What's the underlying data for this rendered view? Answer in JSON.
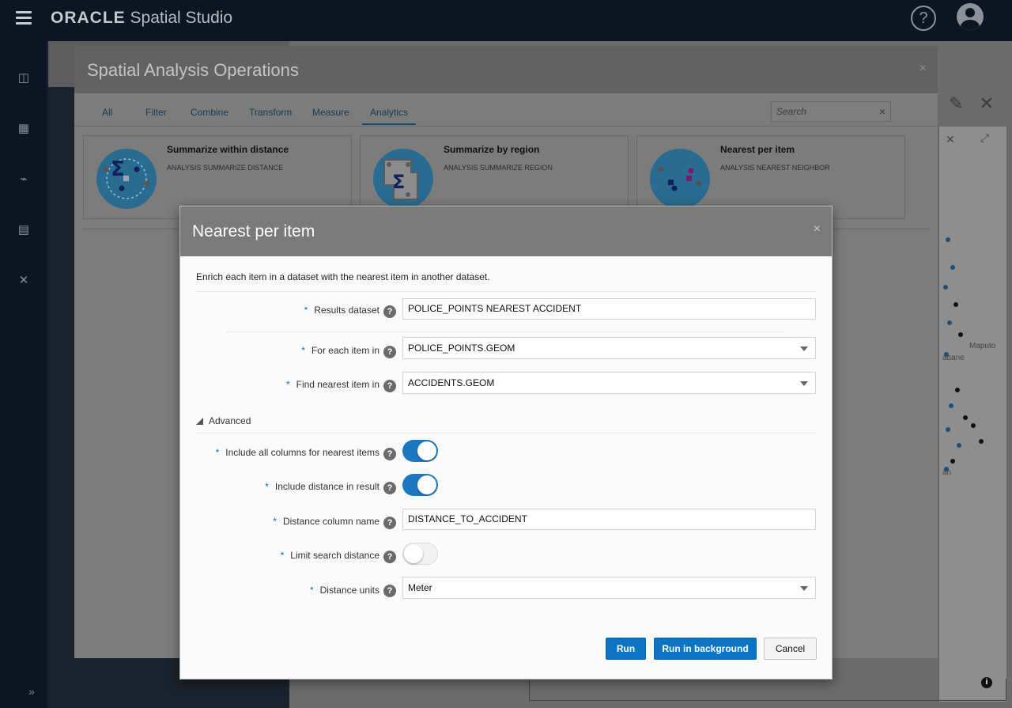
{
  "app": {
    "brand_logo": "ORACLE",
    "brand_product": "Spatial Studio",
    "help_glyph": "?"
  },
  "background": {
    "map_labels": [
      "Maputo",
      "abane",
      "an"
    ]
  },
  "operations_dialog": {
    "title": "Spatial Analysis Operations",
    "close_glyph": "×",
    "tabs": [
      {
        "label": "All"
      },
      {
        "label": "Filter"
      },
      {
        "label": "Combine"
      },
      {
        "label": "Transform"
      },
      {
        "label": "Measure"
      },
      {
        "label": "Analytics",
        "active": true
      }
    ],
    "search_placeholder": "Search",
    "search_clear_glyph": "×",
    "operations": [
      {
        "name": "Summarize within distance",
        "code": "ANALYSIS SUMMARIZE DISTANCE",
        "icon": "summarize-distance-icon"
      },
      {
        "name": "Summarize by region",
        "code": "ANALYSIS SUMMARIZE REGION",
        "icon": "summarize-region-icon"
      },
      {
        "name": "Nearest per item",
        "code": "ANALYSIS NEAREST NEIGHBOR",
        "icon": "nearest-neighbor-icon"
      }
    ]
  },
  "nearest_dialog": {
    "title": "Nearest per item",
    "close_glyph": "×",
    "description": "Enrich each item in a dataset with the nearest item in another dataset.",
    "required_mark": "*",
    "help_glyph": "?",
    "fields": {
      "results_dataset": {
        "label": "Results dataset",
        "value": "POLICE_POINTS NEAREST ACCIDENT"
      },
      "for_each_item_in": {
        "label": "For each item in",
        "value": "POLICE_POINTS.GEOM"
      },
      "find_nearest_item_in": {
        "label": "Find nearest item in",
        "value": "ACCIDENTS.GEOM"
      }
    },
    "advanced": {
      "label": "Advanced",
      "expanded": true,
      "include_all_columns": {
        "label": "Include all columns for nearest items",
        "enabled": true
      },
      "include_distance": {
        "label": "Include distance in result",
        "enabled": true
      },
      "distance_column_name": {
        "label": "Distance column name",
        "value": "DISTANCE_TO_ACCIDENT"
      },
      "limit_search_distance": {
        "label": "Limit search distance",
        "enabled": false
      },
      "distance_units": {
        "label": "Distance units",
        "value": "Meter"
      }
    },
    "buttons": {
      "run": "Run",
      "run_background": "Run in background",
      "cancel": "Cancel"
    }
  },
  "colors": {
    "accent": "#0b74c4",
    "toggle_on": "#1a78c2",
    "dialog_header": "#7a7a7a"
  }
}
